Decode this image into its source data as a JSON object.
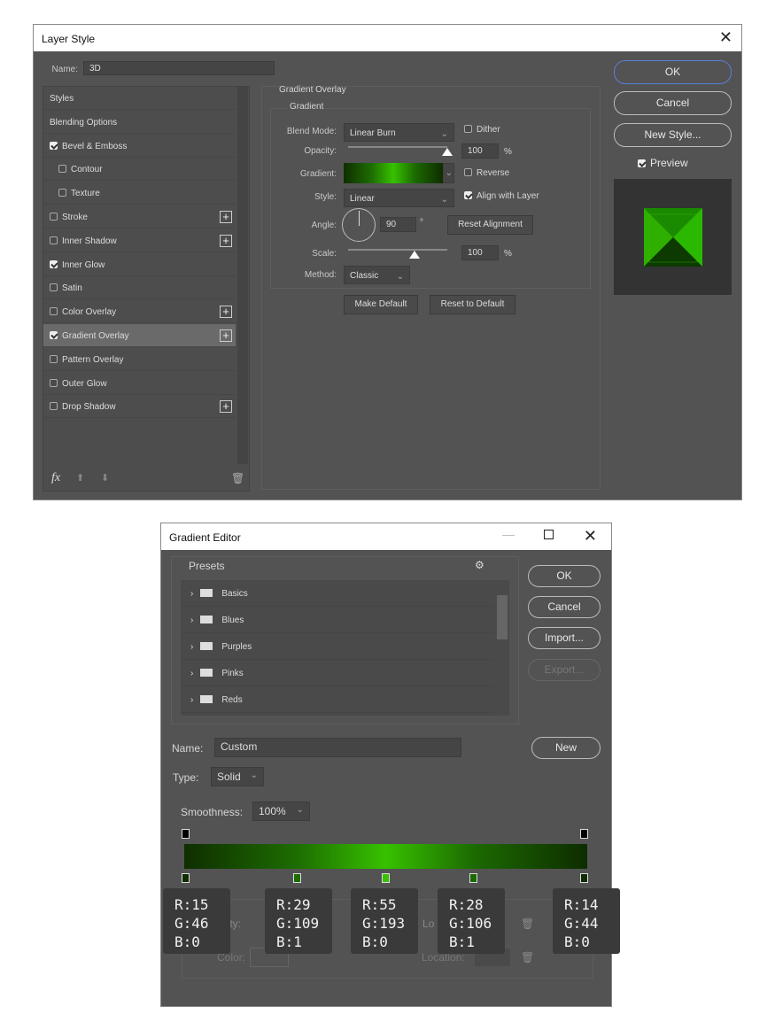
{
  "layer_style": {
    "title": "Layer Style",
    "name_label": "Name:",
    "name_value": "3D",
    "items": [
      {
        "label": "Styles",
        "checkbox": null,
        "plus": false
      },
      {
        "label": "Blending Options",
        "checkbox": null,
        "plus": false
      },
      {
        "label": "Bevel & Emboss",
        "checkbox": true,
        "plus": false
      },
      {
        "label": "Contour",
        "checkbox": false,
        "plus": false,
        "indent": true
      },
      {
        "label": "Texture",
        "checkbox": false,
        "plus": false,
        "indent": true
      },
      {
        "label": "Stroke",
        "checkbox": false,
        "plus": true
      },
      {
        "label": "Inner Shadow",
        "checkbox": false,
        "plus": true
      },
      {
        "label": "Inner Glow",
        "checkbox": true,
        "plus": false
      },
      {
        "label": "Satin",
        "checkbox": false,
        "plus": false
      },
      {
        "label": "Color Overlay",
        "checkbox": false,
        "plus": true
      },
      {
        "label": "Gradient Overlay",
        "checkbox": true,
        "plus": true,
        "selected": true
      },
      {
        "label": "Pattern Overlay",
        "checkbox": false,
        "plus": false
      },
      {
        "label": "Outer Glow",
        "checkbox": false,
        "plus": false
      },
      {
        "label": "Drop Shadow",
        "checkbox": false,
        "plus": true
      }
    ],
    "fx_label": "fx",
    "panel": {
      "section": "Gradient Overlay",
      "group": "Gradient",
      "blend_mode_label": "Blend Mode:",
      "blend_mode": "Linear Burn",
      "dither_label": "Dither",
      "dither": false,
      "opacity_label": "Opacity:",
      "opacity": "100",
      "opacity_pct": 100,
      "gradient_label": "Gradient:",
      "reverse_label": "Reverse",
      "reverse": false,
      "style_label": "Style:",
      "style": "Linear",
      "align_label": "Align with Layer",
      "align": true,
      "angle_label": "Angle:",
      "angle": "90",
      "degree": "°",
      "reset_alignment": "Reset Alignment",
      "scale_label": "Scale:",
      "scale": "100",
      "scale_pct": 100,
      "method_label": "Method:",
      "method": "Classic",
      "percent": "%",
      "make_default": "Make Default",
      "reset_default": "Reset to Default"
    },
    "ok": "OK",
    "cancel": "Cancel",
    "new_style": "New Style...",
    "preview_label": "Preview",
    "preview": true
  },
  "gradient_editor": {
    "title": "Gradient Editor",
    "presets_label": "Presets",
    "presets": [
      "Basics",
      "Blues",
      "Purples",
      "Pinks",
      "Reds"
    ],
    "ok": "OK",
    "cancel": "Cancel",
    "import": "Import...",
    "export": "Export...",
    "name_label": "Name:",
    "name_value": "Custom",
    "new": "New",
    "type_label": "Type:",
    "type_value": "Solid",
    "smoothness_label": "Smoothness:",
    "smoothness_value": "100%",
    "stops_partial": "s",
    "opacity_partial": "acity:",
    "location_partial": "Lo",
    "color_label": "Color:",
    "location_label": "Location:",
    "color_stops": [
      {
        "r": "R:15",
        "g": "G:46",
        "b": "B:0",
        "hex": "#0f2e00"
      },
      {
        "r": "R:29",
        "g": "G:109",
        "b": "B:1",
        "hex": "#1d6d01"
      },
      {
        "r": "R:55",
        "g": "G:193",
        "b": "B:0",
        "hex": "#37c100"
      },
      {
        "r": "R:28",
        "g": "G:106",
        "b": "B:1",
        "hex": "#1c6a01"
      },
      {
        "r": "R:14",
        "g": "G:44",
        "b": "B:0",
        "hex": "#0e2c00"
      }
    ]
  }
}
